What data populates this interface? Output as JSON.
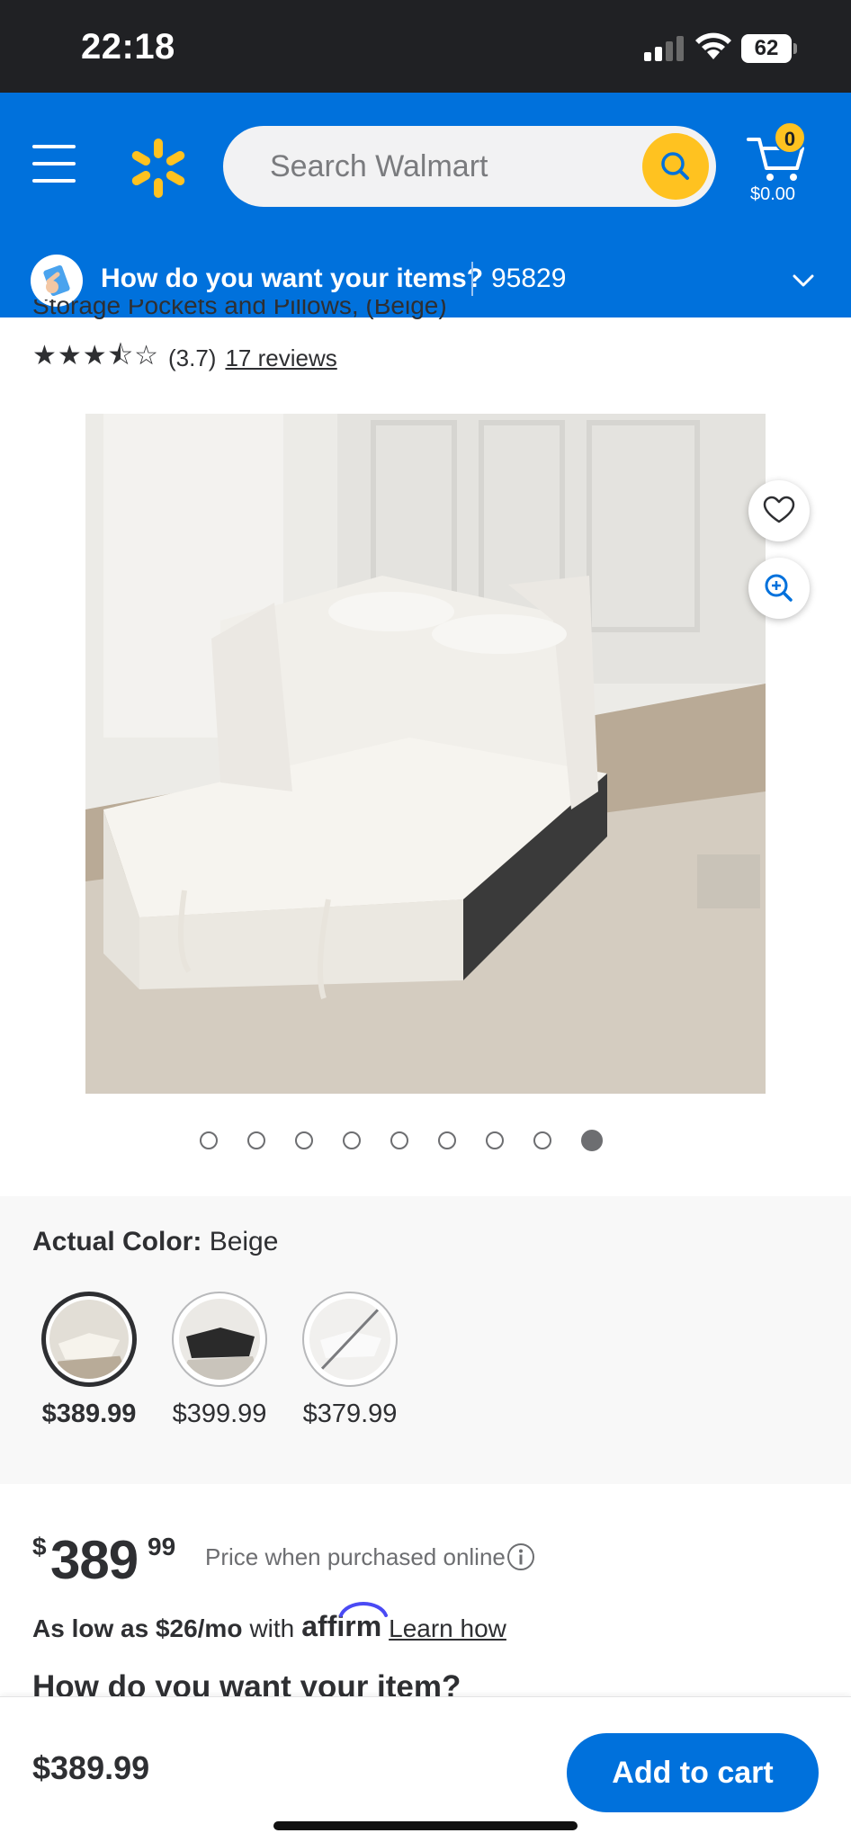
{
  "status_bar": {
    "time": "22:18",
    "battery": "62"
  },
  "header": {
    "search_placeholder": "Search Walmart",
    "cart_count": "0",
    "cart_total": "$0.00"
  },
  "fulfillment": {
    "prompt": "How do you want your items?",
    "zip": "95829"
  },
  "product": {
    "title_fragment": "Storage Pockets and Pillows, (Beige)",
    "stars": "★★★⯪☆",
    "rating": "(3.7)",
    "reviews": "17 reviews",
    "image_count": 9,
    "active_image_index": 8,
    "actual_color_label": "Actual Color:",
    "actual_color_value": "Beige",
    "variants": [
      {
        "price": "$389.99",
        "color": "beige",
        "selected": true
      },
      {
        "price": "$399.99",
        "color": "black",
        "selected": false
      },
      {
        "price": "$379.99",
        "color": "white",
        "selected": false,
        "unavailable": true
      }
    ],
    "price_dollar_sign": "$",
    "price_whole": "389",
    "price_cents": "99",
    "price_note": "Price when purchased online",
    "affirm_prefix": "As low as $26/mo",
    "affirm_with": "with",
    "affirm_brand": "affirm",
    "affirm_link": "Learn how",
    "section_heading": "How do you want your item?"
  },
  "bottom_bar": {
    "price": "$389.99",
    "add_to_cart": "Add to cart"
  },
  "colors": {
    "walmart_blue": "#0071dc",
    "spark_yellow": "#ffc220",
    "text_dark": "#2e2f32"
  }
}
